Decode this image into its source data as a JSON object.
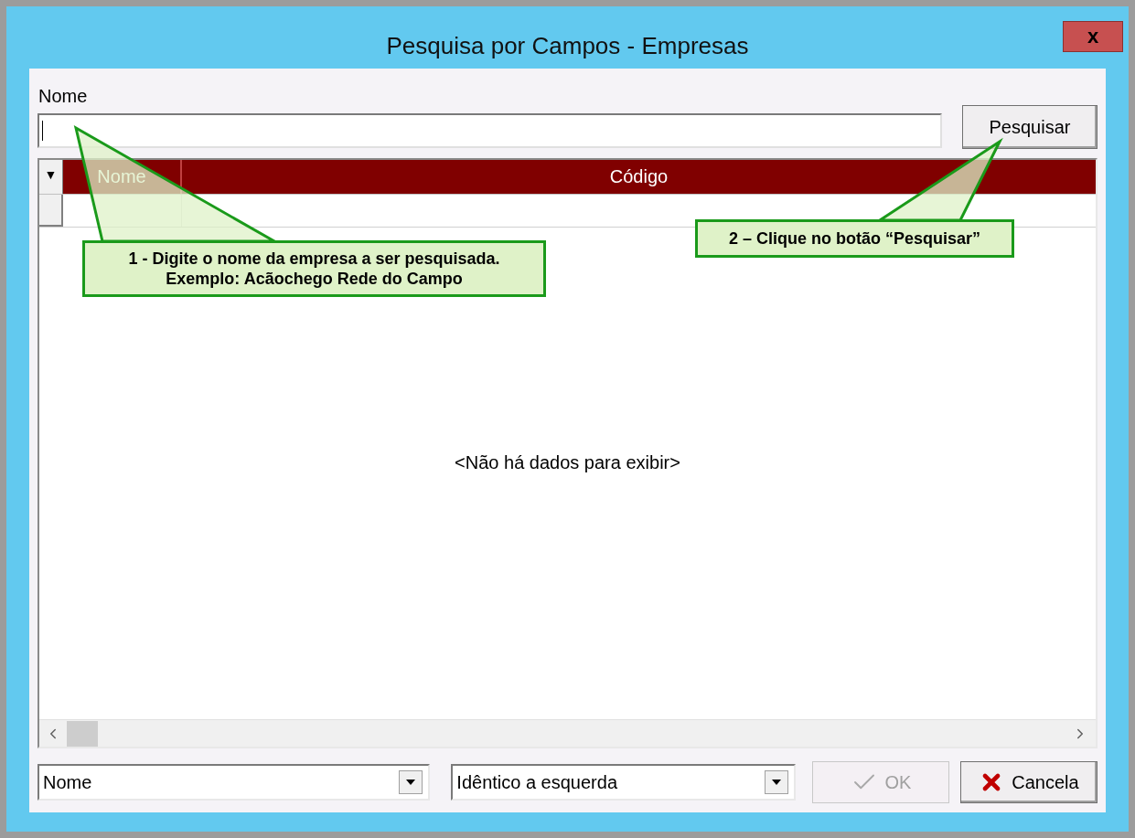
{
  "window": {
    "title": "Pesquisa por Campos - Empresas",
    "close": "x"
  },
  "search": {
    "label": "Nome",
    "button": "Pesquisar"
  },
  "grid": {
    "menu_glyph": "▼",
    "columns": [
      {
        "label": "Nome"
      },
      {
        "label": "Código"
      }
    ],
    "empty_message": "<Não há dados para exibir>"
  },
  "filters": [
    {
      "value": "Nome"
    },
    {
      "value": "Idêntico a esquerda"
    }
  ],
  "buttons": [
    {
      "kind": "ok",
      "label": "OK",
      "disabled": true
    },
    {
      "kind": "cancel",
      "label": "Cancela",
      "disabled": false
    }
  ],
  "callouts": [
    {
      "lines": [
        "1 - Digite o nome da empresa a ser pesquisada.",
        "Exemplo: Acãochego Rede do Campo"
      ]
    },
    {
      "lines": [
        "2 – Clique no botão “Pesquisar”"
      ]
    }
  ]
}
